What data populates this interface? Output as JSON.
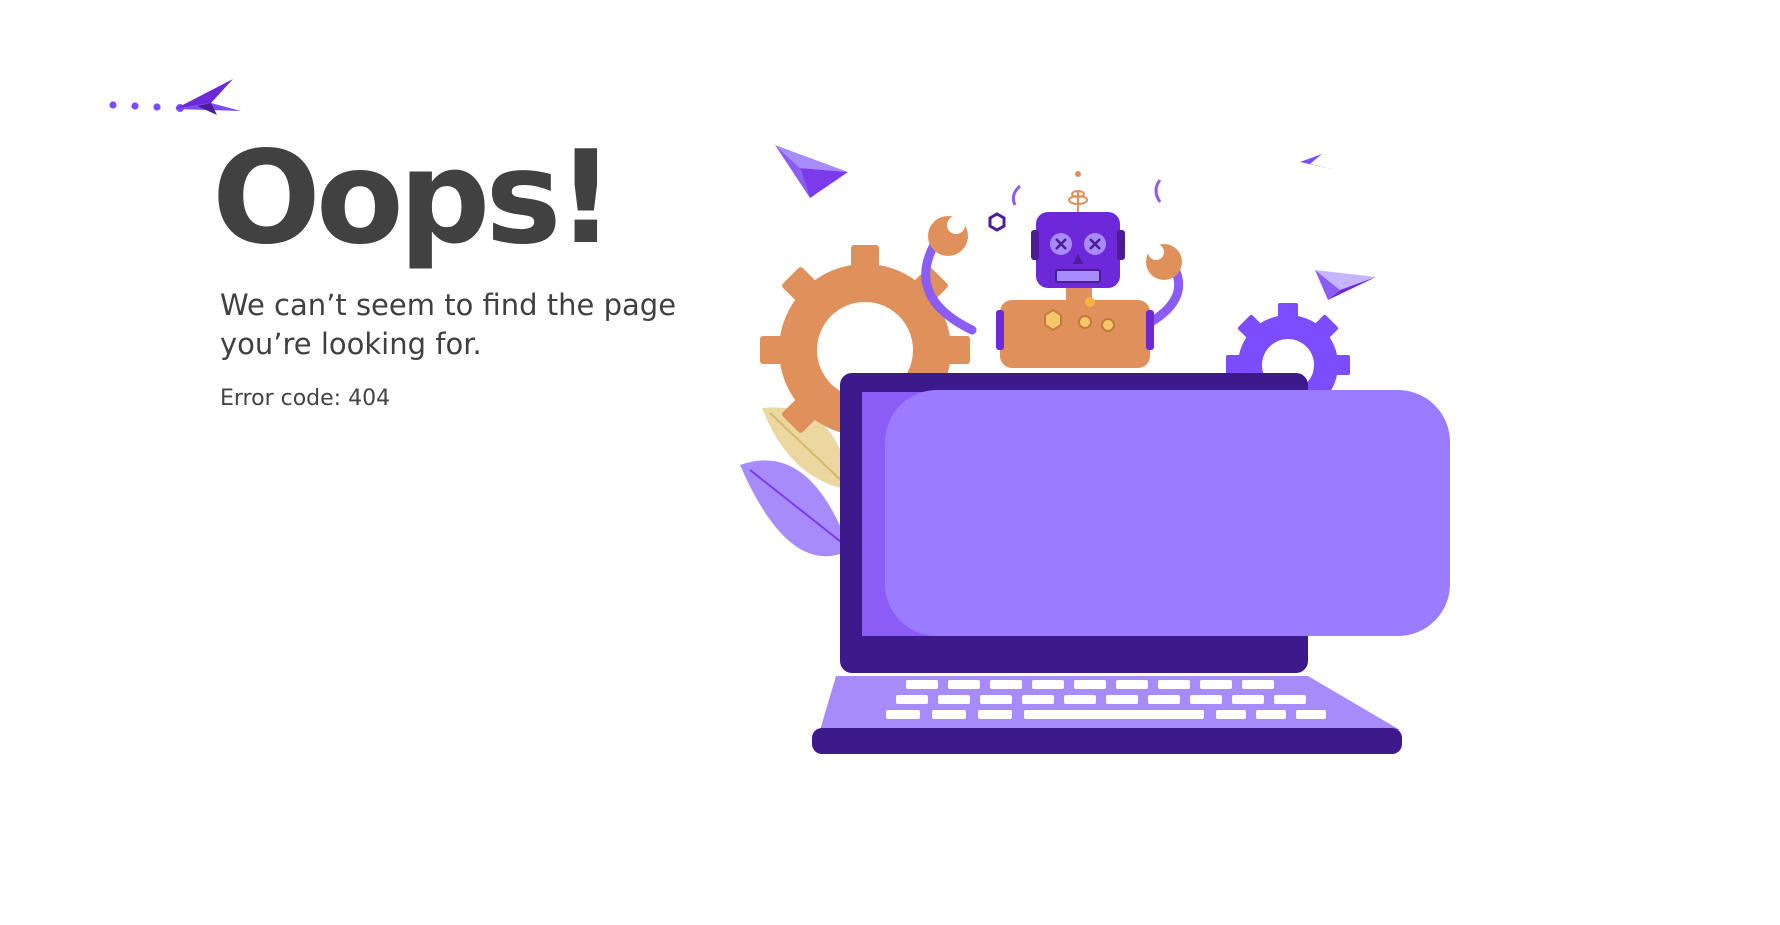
{
  "page": {
    "title": "Oops!",
    "message": "We can’t seem to find the page you’re looking for.",
    "error_code": "Error code: 404"
  },
  "logo": {
    "icon": "paper-plane-icon"
  },
  "illustration": {
    "icon": "broken-robot-laptop-illustration"
  },
  "colors": {
    "text": "#414141",
    "accent": "#7c4dff",
    "purple_dark": "#3d1a8c",
    "purple_mid": "#8b5cf6",
    "purple_light": "#a78bfa",
    "orange": "#e0905a",
    "yellow": "#ecd7a0"
  }
}
